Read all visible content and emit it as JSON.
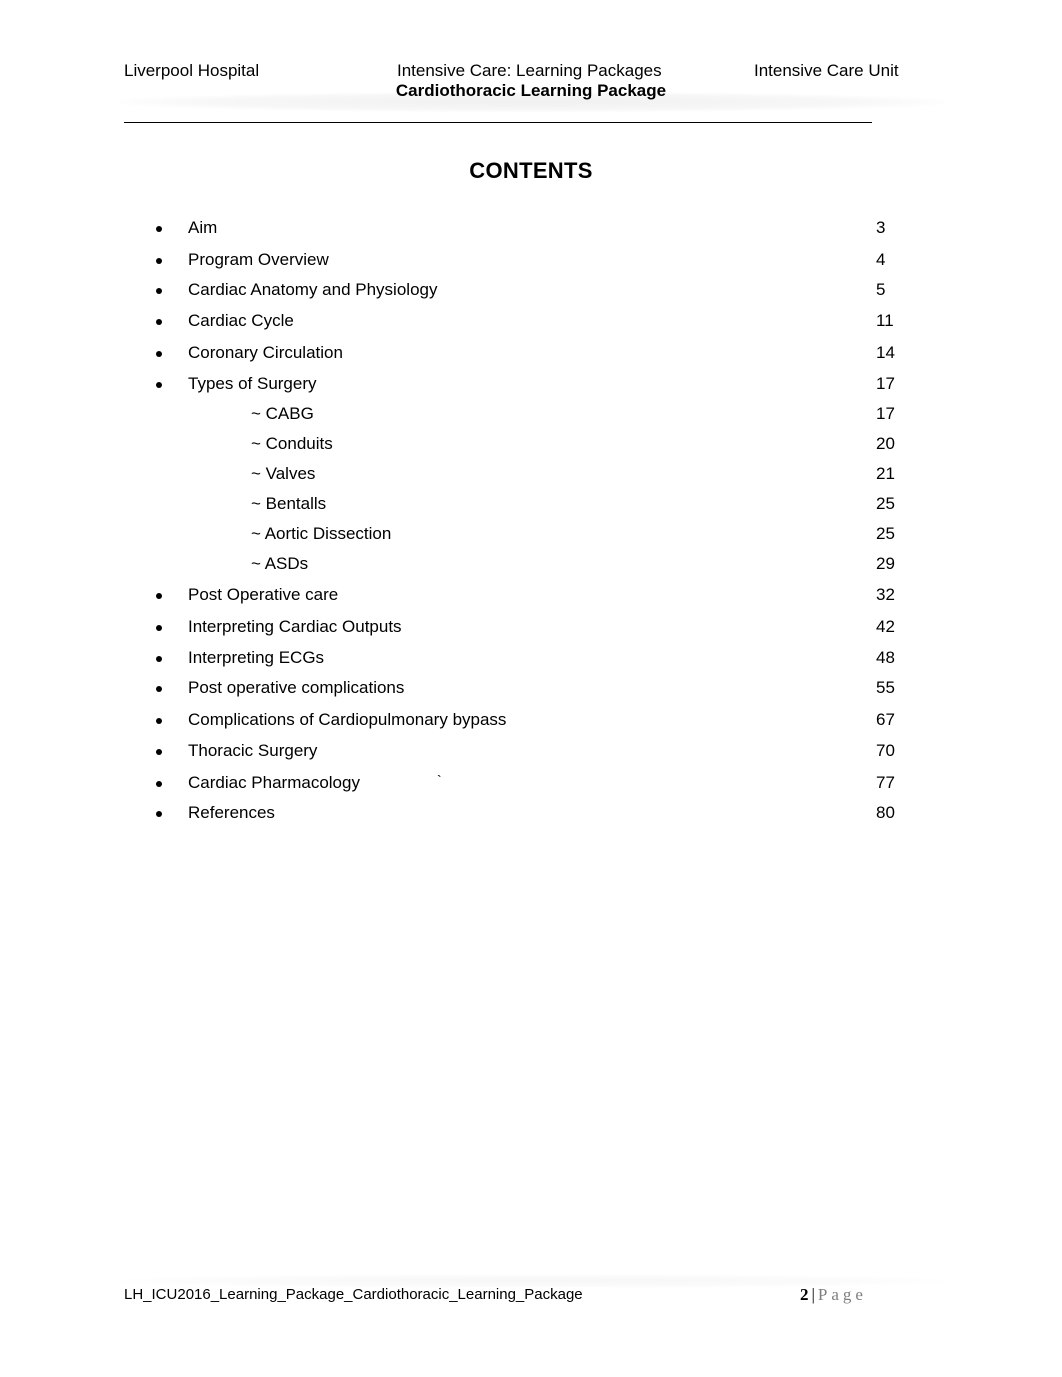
{
  "header": {
    "left": "Liverpool Hospital",
    "center": "Intensive Care: Learning Packages",
    "right": "Intensive Care Unit",
    "subtitle": "Cardiothoracic Learning Package"
  },
  "title": "CONTENTS",
  "toc": [
    {
      "label": "Aim",
      "page": "3",
      "level": 1
    },
    {
      "label": "Program Overview",
      "page": "4",
      "level": 1
    },
    {
      "label": "Cardiac Anatomy and Physiology",
      "page": "5",
      "level": 1
    },
    {
      "label": "Cardiac Cycle",
      "page": "11",
      "level": 1
    },
    {
      "label": "Coronary Circulation",
      "page": "14",
      "level": 1
    },
    {
      "label": "Types of Surgery",
      "page": "17",
      "level": 1
    },
    {
      "label": "~ CABG",
      "page": "17",
      "level": 2
    },
    {
      "label": "~ Conduits",
      "page": "20",
      "level": 2
    },
    {
      "label": "~ Valves",
      "page": "21",
      "level": 2
    },
    {
      "label": "~ Bentalls",
      "page": "25",
      "level": 2
    },
    {
      "label": "~ Aortic Dissection",
      "page": "25",
      "level": 2
    },
    {
      "label": "~ ASDs",
      "page": "29",
      "level": 2
    },
    {
      "label": "Post Operative care",
      "page": "32",
      "level": 1
    },
    {
      "label": "Interpreting Cardiac Outputs",
      "page": "42",
      "level": 1
    },
    {
      "label": "Interpreting ECGs",
      "page": "48",
      "level": 1
    },
    {
      "label": "Post operative complications",
      "page": "55",
      "level": 1
    },
    {
      "label": "Complications of Cardiopulmonary bypass",
      "page": "67",
      "level": 1
    },
    {
      "label": "Thoracic Surgery",
      "page": "70",
      "level": 1
    },
    {
      "label": "Cardiac Pharmacology",
      "page": "77",
      "level": 1
    },
    {
      "label": "References",
      "page": "80",
      "level": 1
    }
  ],
  "stray_mark": "`",
  "footer": {
    "filename": "LH_ICU2016_Learning_Package_Cardiothoracic_Learning_Package",
    "page_number": "2",
    "separator": "|",
    "page_word": "Page"
  }
}
